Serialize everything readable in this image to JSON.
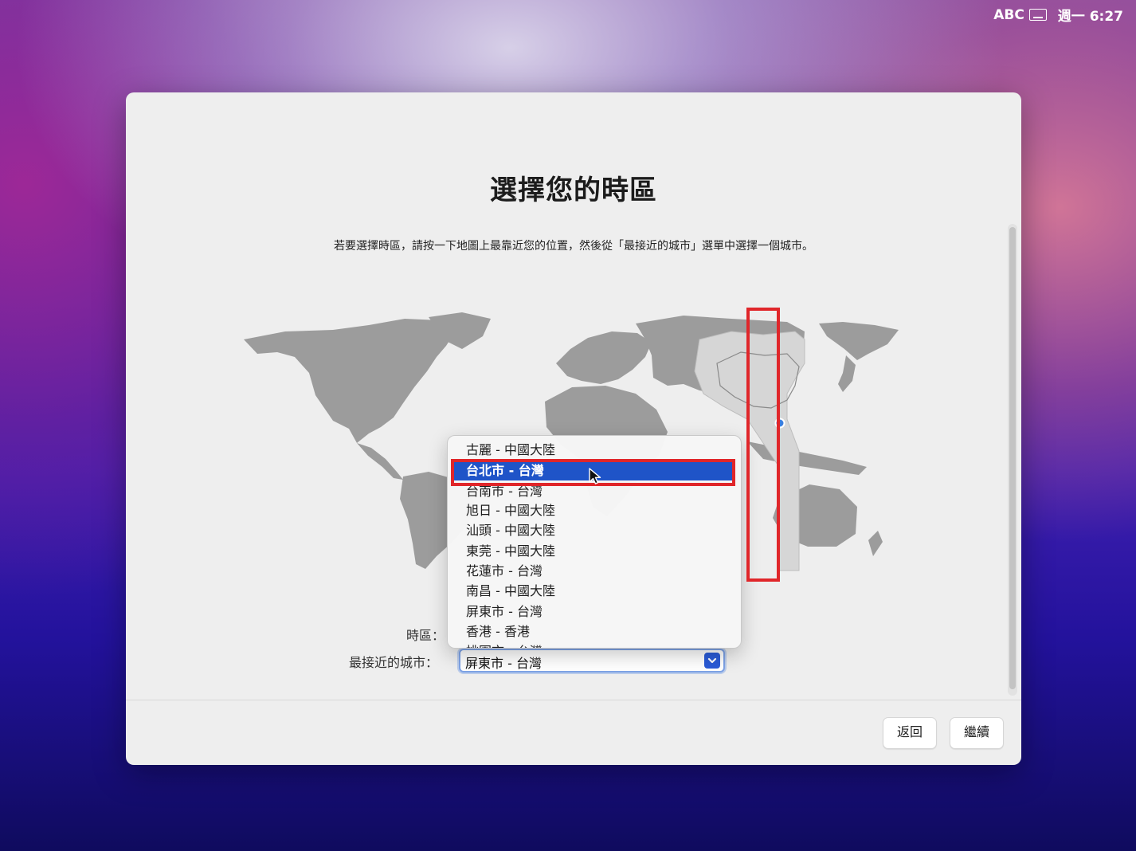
{
  "menubar": {
    "input_source": "ABC",
    "clock": "週一 6:27"
  },
  "window": {
    "title": "選擇您的時區",
    "subtitle": "若要選擇時區，請按一下地圖上最靠近您的位置，然後從「最接近的城市」選單中選擇一個城市。",
    "time_zone_label": "時區：",
    "nearest_city_label": "最接近的城市：",
    "nearest_city_value": "屏東市 - 台灣",
    "back_button": "返回",
    "continue_button": "繼續"
  },
  "dropdown": {
    "items": [
      "古麗 - 中國大陸",
      "台北市 - 台灣",
      "台南市 - 台灣",
      "旭日 - 中國大陸",
      "汕頭 - 中國大陸",
      "東莞 - 中國大陸",
      "花蓮市 - 台灣",
      "南昌 - 中國大陸",
      "屏東市 - 台灣",
      "香港 - 香港",
      "桃園市 - 台灣"
    ],
    "selected_item": "台北市 - 台灣"
  },
  "colors": {
    "selection": "#1f54c8",
    "annotation": "#e0262a",
    "map_land": "#9c9c9c",
    "map_highlight_zone": "#d9d9d9"
  }
}
